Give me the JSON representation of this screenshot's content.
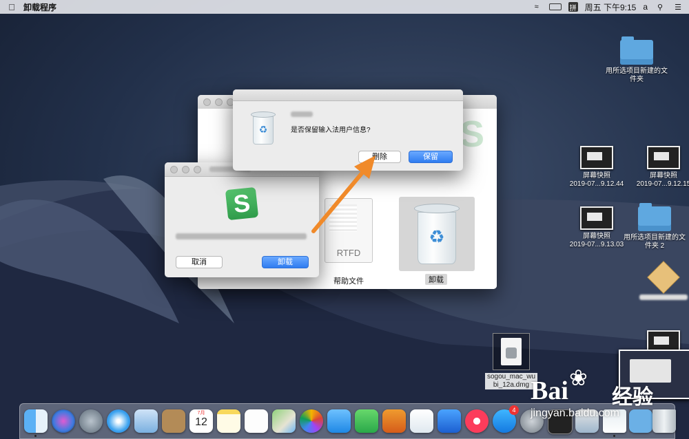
{
  "menubar": {
    "apple_icon": "apple-icon",
    "app_name": "卸载程序",
    "ime": "拼",
    "clock": "周五 下午9:15",
    "user": "a"
  },
  "desktop": {
    "folder1_label": "用所选项目新建的文件夹",
    "shot1_label_line1": "屏幕快照",
    "shot1_label_line2": "2019-07...9.12.44",
    "shot2_label_line1": "屏幕快照",
    "shot2_label_line2": "2019-07...9.12.15",
    "shot3_label_line1": "屏幕快照",
    "shot3_label_line2": "2019-07...9.13.03",
    "folder2_label": "用所选项目新建的文件夹 2",
    "dmg_label": "sogou_mac_wubi_12a.dmg"
  },
  "main_window": {
    "help_file_label": "帮助文件",
    "rtfd_label": "RTFD",
    "uninstall_label": "卸载"
  },
  "uninstall_dialog": {
    "cancel_button": "取消",
    "uninstall_button": "卸载"
  },
  "alert_dialog": {
    "message": "是否保留输入法用户信息?",
    "delete_button": "删除",
    "keep_button": "保留"
  },
  "dock": {
    "calendar_month": "7月",
    "calendar_day": "12",
    "appstore_badge": "4"
  },
  "watermark": {
    "brand": "Bai",
    "brand_cn": "经验",
    "url": "jingyan.baidu.com"
  },
  "colors": {
    "accent_blue": "#2f7cf0",
    "arrow_orange": "#f08a2a",
    "sogou_green": "#2fa84f"
  }
}
